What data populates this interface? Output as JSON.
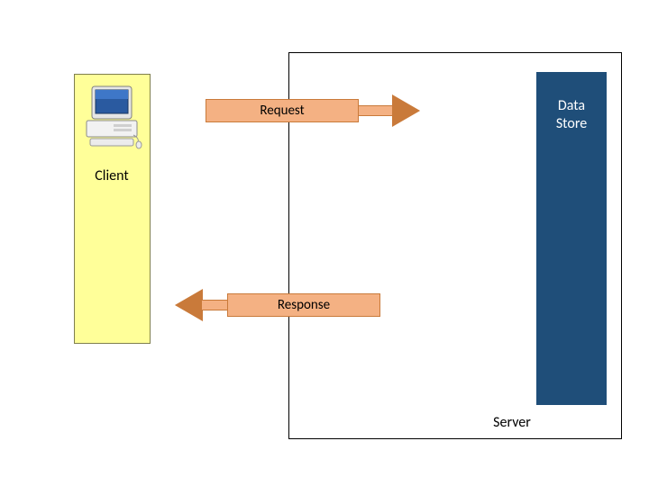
{
  "client": {
    "label": "Client"
  },
  "server": {
    "label": "Server"
  },
  "datastore": {
    "label": "Data\nStore"
  },
  "arrows": {
    "request": {
      "label": "Request"
    },
    "response": {
      "label": "Response"
    }
  },
  "icons": {
    "computer": "computer-icon"
  }
}
